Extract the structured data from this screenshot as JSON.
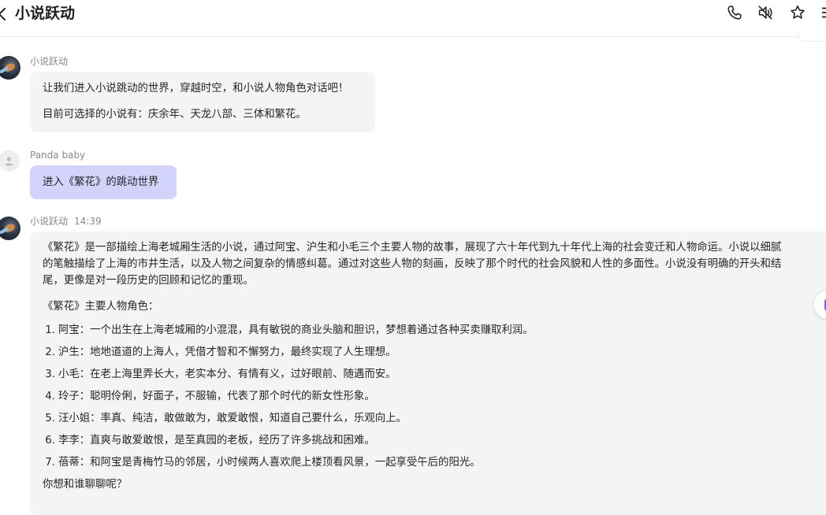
{
  "header": {
    "title": "小说跃动"
  },
  "messages": {
    "m1": {
      "sender": "小说跃动",
      "line1": "让我们进入小说跳动的世界，穿越时空，和小说人物角色对话吧！",
      "line2": "目前可选择的小说有：庆余年、天龙八部、三体和繁花。"
    },
    "m2": {
      "sender": "Panda baby",
      "text": "进入《繁花》的跳动世界"
    },
    "m3": {
      "sender": "小说跃动",
      "time": "14:39",
      "intro_line1": "《繁花》是一部描绘上海老城厢生活的小说，通过阿宝、沪生和小毛三个主要人物的故事，展现了六十年代到九十年代上海的社会变迁和人物命运。小说以细腻",
      "intro_line2": "的笔触描绘了上海的市井生活，以及人物之间复杂的情感纠葛。通过对这些人物的刻画，反映了那个时代的社会风貌和人性的多面性。小说没有明确的开头和结",
      "intro_line3": "尾，更像是对一段历史的回顾和记忆的重现。",
      "roles_heading": "《繁花》主要人物角色：",
      "roles": [
        {
          "num": "1.",
          "text": "阿宝：一个出生在上海老城厢的小混混，具有敏锐的商业头脑和胆识，梦想着通过各种买卖赚取利润。"
        },
        {
          "num": "2.",
          "text": "沪生：地地道道的上海人，凭借才智和不懈努力，最终实现了人生理想。"
        },
        {
          "num": "3.",
          "text": "小毛：在老上海里弄长大，老实本分、有情有义，过好眼前、随遇而安。"
        },
        {
          "num": "4.",
          "text": "玲子：聪明伶俐，好面子，不服输，代表了那个时代的新女性形象。"
        },
        {
          "num": "5.",
          "text": "汪小姐：率真、纯洁，敢做敢为，敢爱敢恨，知道自己要什么，乐观向上。"
        },
        {
          "num": "6.",
          "text": "李李：直爽与敢爱敢恨，是至真园的老板，经历了许多挑战和困难。"
        },
        {
          "num": "7.",
          "text": "蓓蒂：和阿宝是青梅竹马的邻居，小时候两人喜欢爬上楼顶看风景，一起享受午后的阳光。"
        }
      ],
      "question": "你想和谁聊聊呢？"
    }
  },
  "icons": {
    "back": "chevron-left-icon",
    "call": "phone-icon",
    "mute": "speaker-muted-icon",
    "favorite": "star-icon",
    "menu": "menu-icon",
    "user_avatar": "user-icon"
  },
  "colors": {
    "user_bubble": "#d2d3fb",
    "bot_bubble": "#f4f4f4",
    "accent": "#7a5cff"
  }
}
